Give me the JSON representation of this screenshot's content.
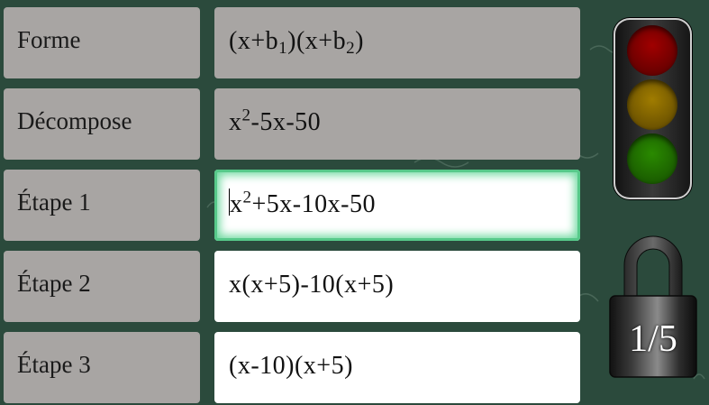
{
  "rows": [
    {
      "label": "Forme",
      "field_parts": [
        "(x+b",
        "1",
        ")(x+b",
        "2",
        ")"
      ]
    },
    {
      "label": "Décompose",
      "field_parts": [
        "x",
        "2",
        "-5x-50"
      ]
    },
    {
      "label": "Étape 1",
      "field_parts": [
        "x",
        "2",
        "+5x-10x-50"
      ]
    },
    {
      "label": "Étape 2",
      "field_text": "x(x+5)-10(x+5)"
    },
    {
      "label": "Étape 3",
      "field_text": "(x-10)(x+5)"
    }
  ],
  "lock": {
    "counter": "1/5",
    "icon": "padlock-icon"
  },
  "traffic_light": {
    "icon": "traffic-light-icon",
    "lamp_colors": [
      "#8a0000",
      "#8a6a00",
      "#1f7a00"
    ]
  },
  "colors": {
    "background": "#2b4a3c",
    "label_bg": "#a8a5a3",
    "field_bg": "#ffffff",
    "focus_glow": "#57c98a"
  }
}
